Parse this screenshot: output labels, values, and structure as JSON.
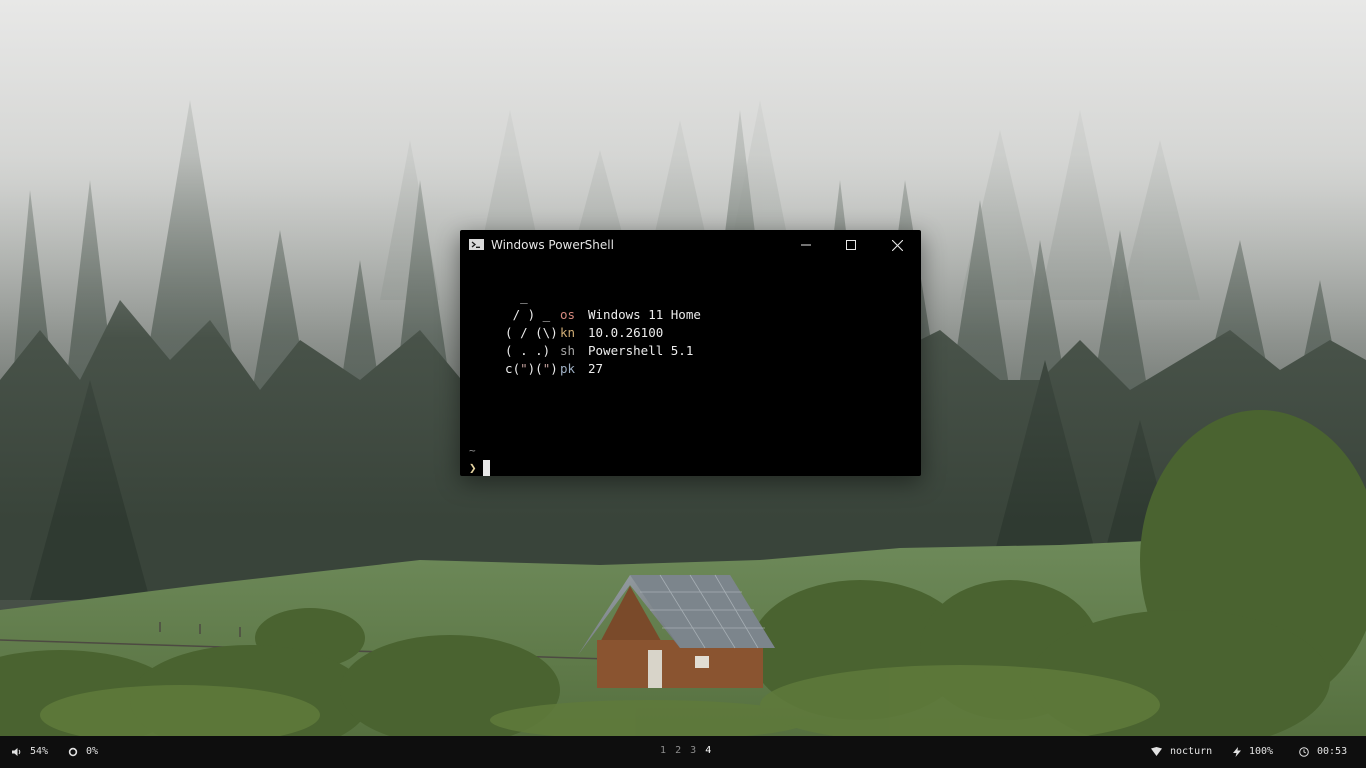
{
  "window": {
    "title": "Windows PowerShell",
    "icon": "powershell-icon",
    "controls": [
      "minimize-icon",
      "maximize-icon",
      "close-icon"
    ]
  },
  "fetch": {
    "ascii": {
      "line1": "    _",
      "line2": "   / ) _",
      "line3": "  ( / (\\)",
      "line4": "  ( . .)",
      "line5a": "  c(",
      "q1": "\"",
      "line5b": ")(",
      "q2": "\"",
      "line5c": ")"
    },
    "rows": [
      {
        "key": "os",
        "value": "Windows 11 Home",
        "key_color": "#d78a7f"
      },
      {
        "key": "kn",
        "value": "10.0.26100",
        "key_color": "#d0ad76"
      },
      {
        "key": "sh",
        "value": "Powershell 5.1",
        "key_color": "#a6a6a6"
      },
      {
        "key": "pk",
        "value": "27",
        "key_color": "#9fb0c4"
      }
    ]
  },
  "prompt": {
    "cwd": "~",
    "symbol": "❯"
  },
  "taskbar": {
    "volume": {
      "icon": "volume-icon",
      "value": "54%"
    },
    "brightness": {
      "icon": "brightness-icon",
      "value": "0%"
    },
    "workspaces": [
      "1",
      "2",
      "3",
      "4"
    ],
    "active_workspace": "4",
    "wifi": {
      "icon": "wifi-icon",
      "value": "nocturn"
    },
    "battery": {
      "icon": "battery-bolt-icon",
      "value": "100%"
    },
    "clock": {
      "icon": "clock-icon",
      "value": "00:53"
    }
  }
}
